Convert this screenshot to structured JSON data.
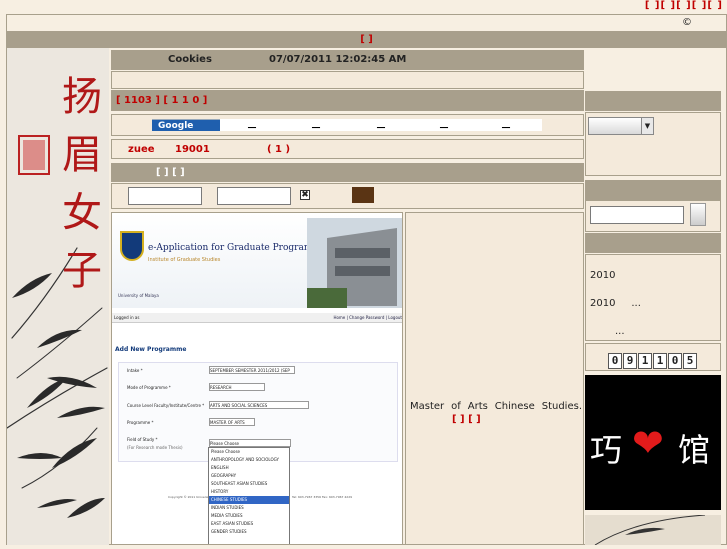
{
  "header": {
    "top_links": "[ ][ ][ ][ ][ ]",
    "copyright": "©",
    "red_links": "[ ]"
  },
  "main": {
    "cookies_label": "Cookies",
    "datetime": "07/07/2011 12:02:45 AM",
    "stats_line": "[ 1103 ] [ 1 1 0 ]",
    "search_brand": "Google",
    "user_name": "zuee",
    "user_id": "19001",
    "user_count": "( 1 )",
    "login_links": "[ ] [ ]",
    "username_value": "",
    "password_value": "",
    "article_text": "Master of Arts Chinese Studies.",
    "article_links": "[ ] [ ]"
  },
  "screenshot": {
    "banner_title": "e-Application for Graduate Programmes",
    "banner_sub": "Institute of Graduate Studies",
    "university": "University of Malaya",
    "login_left": "Logged in as",
    "login_right": "Home | Change Password | Logout",
    "form_title": "Add New Programme",
    "fields": [
      {
        "label": "Intake *",
        "value": "SEPTEMBER SEMESTER 2011/2012 (SEP 2011)"
      },
      {
        "label": "Mode of Programme *",
        "value": "RESEARCH"
      },
      {
        "label": "Course Level Faculty/Institute/Centre *",
        "value": "ARTS AND SOCIAL SCIENCES"
      },
      {
        "label": "Programme *",
        "value": "MASTER OF ARTS"
      },
      {
        "label": "Field of Study *",
        "value": "Please Choose"
      }
    ],
    "field_note": "(For Research mode Thesis)",
    "dropdown_options": [
      "Please Choose",
      "ANTHROPOLOGY AND SOCIOLOGY",
      "ENGLISH",
      "GEOGRAPHY",
      "SOUTHEAST ASIAN STUDIES",
      "HISTORY",
      "CHINESE STUDIES",
      "INDIAN STUDIES",
      "MEDIA STUDIES",
      "EAST ASIAN STUDIES",
      "GENDER STUDIES"
    ],
    "footer1": "Copyright © 2011 University of Malaya, 50603 Kuala Lumpur, Malaysia",
    "footer2": "Tel: 603-7967 3356 Fax: 603-7967 4229"
  },
  "sidebar": {
    "news": [
      {
        "year": "2010",
        "text": ""
      },
      {
        "year": "2010",
        "text": "..."
      }
    ],
    "more": "...",
    "counter": [
      "0",
      "9",
      "1",
      "1",
      "0",
      "5"
    ],
    "logo_left": "巧",
    "logo_right": "馆"
  },
  "art": {
    "calligraphy": [
      "扬",
      "眉",
      "女",
      "子"
    ]
  },
  "colors": {
    "bar": "#a89f8c",
    "accent_red": "#c00000",
    "background": "#f7efe2"
  }
}
